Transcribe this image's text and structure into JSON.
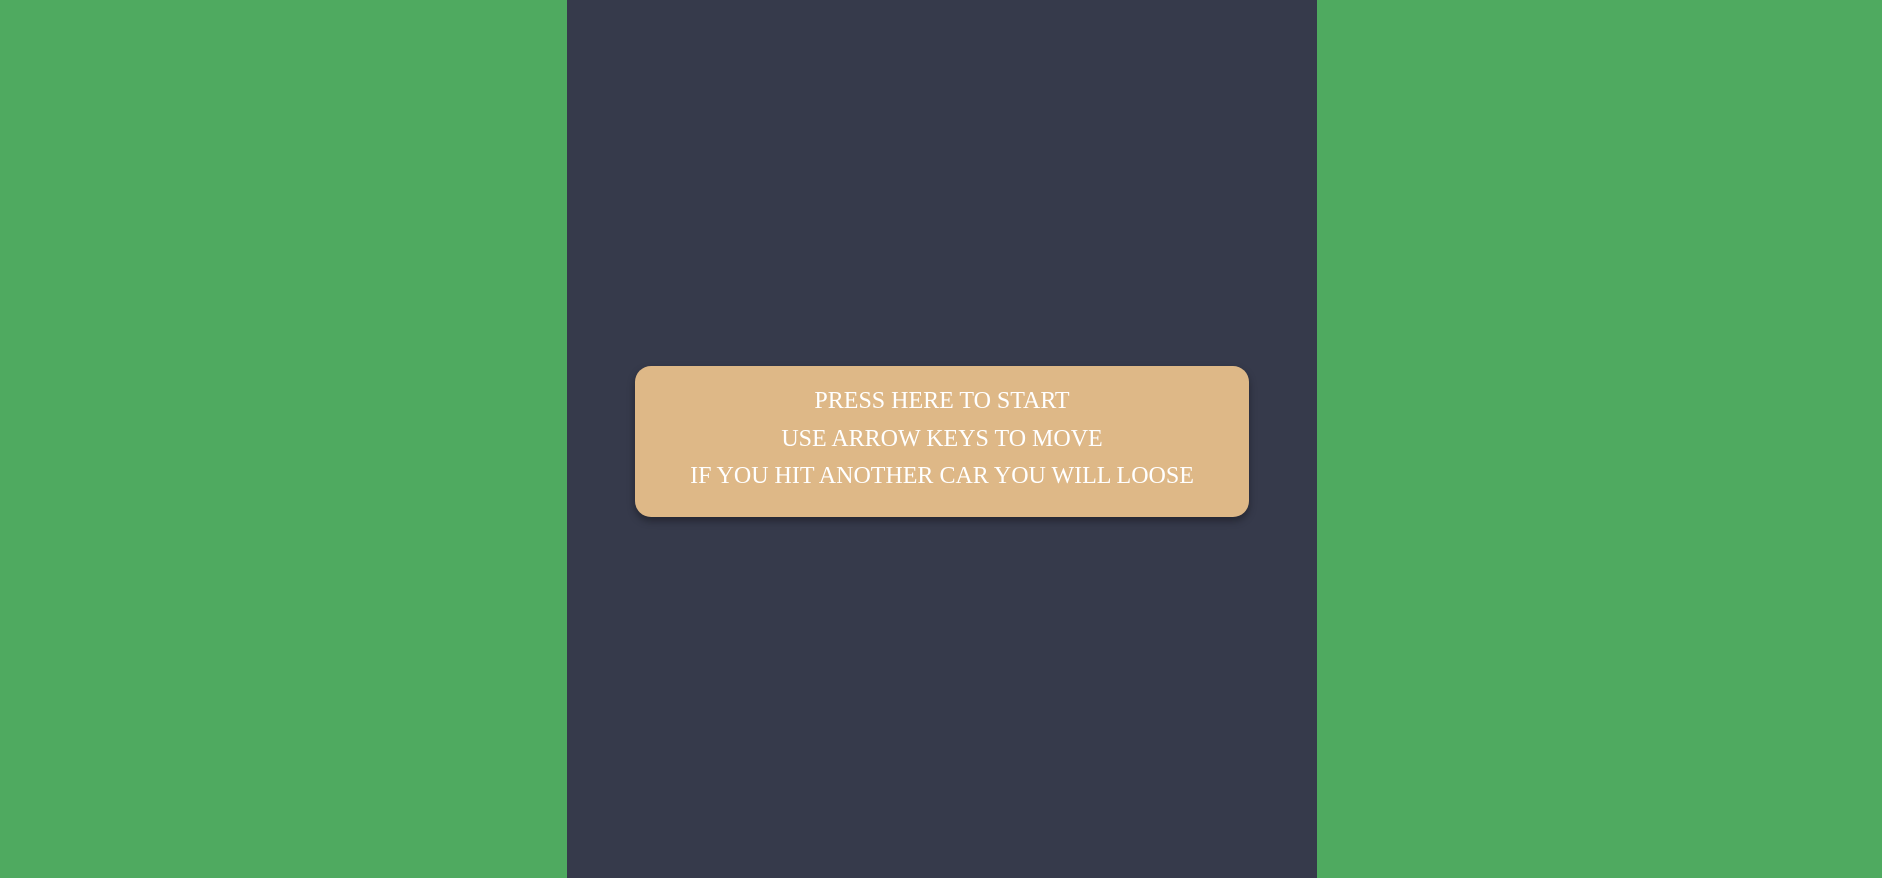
{
  "colors": {
    "grass": "#4faa60",
    "road": "#363a4b",
    "panel": "#deb887",
    "text": "#ffffff"
  },
  "start_panel": {
    "line1": "PRESS HERE TO START",
    "line2": "USE ARROW KEYS TO MOVE",
    "line3": "IF YOU HIT ANOTHER CAR YOU WILL LOOSE"
  }
}
